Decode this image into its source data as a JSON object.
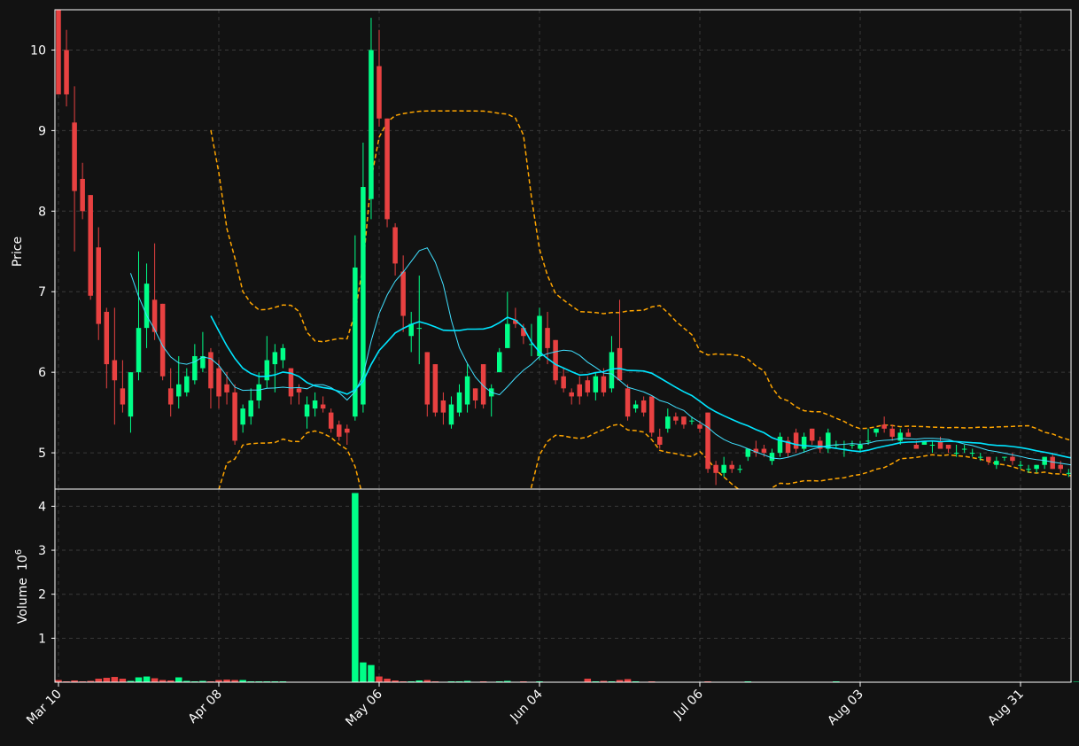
{
  "chart_data": {
    "type": "candlestick",
    "price_panel": {
      "ylabel": "Price",
      "ylim": [
        4.55,
        10.5
      ],
      "yticks": [
        5,
        6,
        7,
        8,
        9,
        10
      ],
      "grid": true
    },
    "volume_panel": {
      "ylabel": "Volume",
      "ylabel_exponent": "10",
      "ylabel_exponent_power": "6",
      "ylim": [
        0,
        4.35
      ],
      "yticks": [
        1,
        2,
        3,
        4
      ],
      "grid": true
    },
    "x_axis": {
      "tick_labels": [
        "Mar 10",
        "Apr 08",
        "May 06",
        "Jun 04",
        "Jul 06",
        "Aug 03",
        "Aug 31"
      ],
      "tick_index": [
        0,
        20,
        40,
        60,
        80,
        100,
        120
      ]
    },
    "colors": {
      "background": "#121212",
      "up": "#00ff88",
      "down": "#e84141",
      "ma_fast": "#40e0ff",
      "ma_slow": "#00e5ff",
      "bands": "#ffa500",
      "grid": "#3a3a3a",
      "frame": "#ffffff"
    },
    "ohlc": [
      [
        10.5,
        10.5,
        9.45,
        9.45
      ],
      [
        10.0,
        10.25,
        9.3,
        9.45
      ],
      [
        9.1,
        9.55,
        7.5,
        8.25
      ],
      [
        8.4,
        8.6,
        7.9,
        8.0
      ],
      [
        8.2,
        8.2,
        6.9,
        6.95
      ],
      [
        7.55,
        7.8,
        6.4,
        6.6
      ],
      [
        6.75,
        6.8,
        5.8,
        6.1
      ],
      [
        6.15,
        6.8,
        5.35,
        5.9
      ],
      [
        5.8,
        6.15,
        5.5,
        5.6
      ],
      [
        5.45,
        6.0,
        5.25,
        6.0
      ],
      [
        6.0,
        7.5,
        5.9,
        6.55
      ],
      [
        6.55,
        7.35,
        6.3,
        7.1
      ],
      [
        6.9,
        7.6,
        6.4,
        6.5
      ],
      [
        6.85,
        6.85,
        5.9,
        5.95
      ],
      [
        5.8,
        6.05,
        5.45,
        5.6
      ],
      [
        5.7,
        6.2,
        5.55,
        5.85
      ],
      [
        5.75,
        6.05,
        5.7,
        5.95
      ],
      [
        5.9,
        6.35,
        5.85,
        6.2
      ],
      [
        6.05,
        6.5,
        6.0,
        6.2
      ],
      [
        6.25,
        6.3,
        5.55,
        5.8
      ],
      [
        6.05,
        6.15,
        5.55,
        5.7
      ],
      [
        5.85,
        6.0,
        5.6,
        5.75
      ],
      [
        5.75,
        5.85,
        5.1,
        5.15
      ],
      [
        5.35,
        5.6,
        5.25,
        5.55
      ],
      [
        5.45,
        5.8,
        5.35,
        5.65
      ],
      [
        5.65,
        6.0,
        5.55,
        5.85
      ],
      [
        5.9,
        6.45,
        5.8,
        6.15
      ],
      [
        6.1,
        6.35,
        5.75,
        6.25
      ],
      [
        6.15,
        6.35,
        6.05,
        6.3
      ],
      [
        6.05,
        6.05,
        5.6,
        5.7
      ],
      [
        5.8,
        5.85,
        5.6,
        5.75
      ],
      [
        5.45,
        5.7,
        5.3,
        5.6
      ],
      [
        5.55,
        5.75,
        5.45,
        5.65
      ],
      [
        5.6,
        5.7,
        5.5,
        5.55
      ],
      [
        5.5,
        5.55,
        5.25,
        5.3
      ],
      [
        5.35,
        5.4,
        5.15,
        5.2
      ],
      [
        5.3,
        5.35,
        5.1,
        5.25
      ],
      [
        5.45,
        7.7,
        5.4,
        7.3
      ],
      [
        5.6,
        8.85,
        5.5,
        8.3
      ],
      [
        8.15,
        10.4,
        7.9,
        10.0
      ],
      [
        9.8,
        10.25,
        9.05,
        9.15
      ],
      [
        9.15,
        9.15,
        7.8,
        7.9
      ],
      [
        7.8,
        7.85,
        7.2,
        7.35
      ],
      [
        7.25,
        7.45,
        6.5,
        6.7
      ],
      [
        6.45,
        6.75,
        6.25,
        6.6
      ],
      [
        6.55,
        7.2,
        6.1,
        6.55
      ],
      [
        6.25,
        6.25,
        5.45,
        5.6
      ],
      [
        6.1,
        6.1,
        5.45,
        5.5
      ],
      [
        5.65,
        5.75,
        5.35,
        5.5
      ],
      [
        5.35,
        5.7,
        5.3,
        5.6
      ],
      [
        5.5,
        5.85,
        5.45,
        5.75
      ],
      [
        5.6,
        6.1,
        5.5,
        5.95
      ],
      [
        5.8,
        5.8,
        5.55,
        5.65
      ],
      [
        6.1,
        6.1,
        5.55,
        5.6
      ],
      [
        5.7,
        5.85,
        5.45,
        5.8
      ],
      [
        6.0,
        6.3,
        6.0,
        6.25
      ],
      [
        6.3,
        7.0,
        6.3,
        6.6
      ],
      [
        6.65,
        6.8,
        6.55,
        6.6
      ],
      [
        6.55,
        6.6,
        6.35,
        6.45
      ],
      [
        6.35,
        6.6,
        6.2,
        6.35
      ],
      [
        6.2,
        6.8,
        6.15,
        6.7
      ],
      [
        6.55,
        6.75,
        6.1,
        6.3
      ],
      [
        6.4,
        6.4,
        5.85,
        5.9
      ],
      [
        5.95,
        6.05,
        5.75,
        5.8
      ],
      [
        5.75,
        5.8,
        5.6,
        5.7
      ],
      [
        5.85,
        5.95,
        5.6,
        5.7
      ],
      [
        5.9,
        5.95,
        5.7,
        5.75
      ],
      [
        5.75,
        6.0,
        5.65,
        5.95
      ],
      [
        5.95,
        6.05,
        5.7,
        5.75
      ],
      [
        5.8,
        6.45,
        5.75,
        6.25
      ],
      [
        6.3,
        6.9,
        6.0,
        5.9
      ],
      [
        5.8,
        5.85,
        5.4,
        5.45
      ],
      [
        5.55,
        5.65,
        5.5,
        5.6
      ],
      [
        5.65,
        5.7,
        5.45,
        5.5
      ],
      [
        5.7,
        5.7,
        5.2,
        5.25
      ],
      [
        5.2,
        5.3,
        5.05,
        5.1
      ],
      [
        5.3,
        5.55,
        5.25,
        5.45
      ],
      [
        5.45,
        5.5,
        5.35,
        5.4
      ],
      [
        5.45,
        5.45,
        5.3,
        5.35
      ],
      [
        5.4,
        5.45,
        5.35,
        5.4
      ],
      [
        5.35,
        5.4,
        5.25,
        5.3
      ],
      [
        5.5,
        5.5,
        4.75,
        4.8
      ],
      [
        4.85,
        4.9,
        4.6,
        4.75
      ],
      [
        4.75,
        4.95,
        4.7,
        4.85
      ],
      [
        4.85,
        4.9,
        4.75,
        4.8
      ],
      [
        4.8,
        4.85,
        4.75,
        4.8
      ],
      [
        4.95,
        5.05,
        4.9,
        5.05
      ],
      [
        5.05,
        5.15,
        4.95,
        5.0
      ],
      [
        5.05,
        5.1,
        4.95,
        5.0
      ],
      [
        4.9,
        5.05,
        4.85,
        5.0
      ],
      [
        5.0,
        5.25,
        4.95,
        5.2
      ],
      [
        5.15,
        5.2,
        4.95,
        5.0
      ],
      [
        5.25,
        5.3,
        5.0,
        5.05
      ],
      [
        5.05,
        5.25,
        5.0,
        5.2
      ],
      [
        5.3,
        5.3,
        5.1,
        5.15
      ],
      [
        5.15,
        5.2,
        5.0,
        5.05
      ],
      [
        5.05,
        5.3,
        5.0,
        5.25
      ],
      [
        5.1,
        5.15,
        5.05,
        5.1
      ],
      [
        5.05,
        5.15,
        4.95,
        5.05
      ],
      [
        5.1,
        5.15,
        5.05,
        5.1
      ],
      [
        5.05,
        5.15,
        5.0,
        5.1
      ],
      [
        5.15,
        5.3,
        5.1,
        5.15
      ],
      [
        5.25,
        5.3,
        5.2,
        5.3
      ],
      [
        5.35,
        5.45,
        5.25,
        5.3
      ],
      [
        5.3,
        5.35,
        5.15,
        5.2
      ],
      [
        5.15,
        5.3,
        5.1,
        5.25
      ],
      [
        5.25,
        5.3,
        5.2,
        5.2
      ],
      [
        5.1,
        5.15,
        5.05,
        5.05
      ],
      [
        5.1,
        5.15,
        5.1,
        5.15
      ],
      [
        5.1,
        5.15,
        5.0,
        5.1
      ],
      [
        5.15,
        5.2,
        5.05,
        5.05
      ],
      [
        5.1,
        5.1,
        5.0,
        5.05
      ],
      [
        5.0,
        5.1,
        4.95,
        5.0
      ],
      [
        5.05,
        5.1,
        5.0,
        5.05
      ],
      [
        5.0,
        5.05,
        4.95,
        5.0
      ],
      [
        4.95,
        5.0,
        4.9,
        4.95
      ],
      [
        4.95,
        4.95,
        4.85,
        4.9
      ],
      [
        4.85,
        4.95,
        4.8,
        4.9
      ],
      [
        4.95,
        4.95,
        4.9,
        4.95
      ],
      [
        4.95,
        5.0,
        4.85,
        4.9
      ],
      [
        4.85,
        4.9,
        4.8,
        4.85
      ],
      [
        4.8,
        4.85,
        4.75,
        4.8
      ],
      [
        4.8,
        4.85,
        4.75,
        4.85
      ],
      [
        4.85,
        4.95,
        4.8,
        4.95
      ],
      [
        4.95,
        5.0,
        4.8,
        4.8
      ],
      [
        4.85,
        4.9,
        4.75,
        4.8
      ],
      [
        4.75,
        4.8,
        4.7,
        4.75
      ],
      [
        4.7,
        4.75,
        4.65,
        4.72
      ],
      [
        4.8,
        4.8,
        4.7,
        4.72
      ]
    ],
    "volume": [
      0.05,
      0.02,
      0.04,
      0.02,
      0.03,
      0.08,
      0.1,
      0.12,
      0.08,
      0.03,
      0.11,
      0.13,
      0.09,
      0.05,
      0.04,
      0.11,
      0.03,
      0.02,
      0.03,
      0.02,
      0.05,
      0.06,
      0.05,
      0.05,
      0.02,
      0.02,
      0.02,
      0.02,
      0.02,
      0.01,
      0.01,
      0.01,
      0.01,
      0.01,
      0.01,
      0.01,
      0.01,
      4.3,
      0.45,
      0.39,
      0.13,
      0.08,
      0.04,
      0.02,
      0.02,
      0.04,
      0.05,
      0.02,
      0.01,
      0.02,
      0.02,
      0.03,
      0.01,
      0.02,
      0.01,
      0.02,
      0.03,
      0.01,
      0.02,
      0.01,
      0.02,
      0.01,
      0.01,
      0.01,
      0.01,
      0.01,
      0.08,
      0.02,
      0.03,
      0.02,
      0.05,
      0.07,
      0.02,
      0.01,
      0.02,
      0.01,
      0.01,
      0.01,
      0.01,
      0.01,
      0.01,
      0.02,
      0.01,
      0.01,
      0.01,
      0.01,
      0.02,
      0.01,
      0.01,
      0.01,
      0.01,
      0.01,
      0.01,
      0.01,
      0.01,
      0.01,
      0.01,
      0.02,
      0.01,
      0.01,
      0.01,
      0.01,
      0.01,
      0.01,
      0.01,
      0.01,
      0.01,
      0.01,
      0.01,
      0.01,
      0.01,
      0.01,
      0.01,
      0.01,
      0.01,
      0.01,
      0.01,
      0.01,
      0.01,
      0.01,
      0.01,
      0.01,
      0.01,
      0.01,
      0.01,
      0.01,
      0.01,
      0.01,
      0.01
    ]
  }
}
